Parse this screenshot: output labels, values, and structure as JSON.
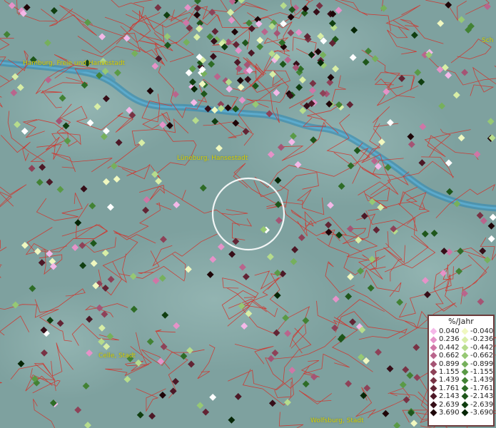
{
  "map": {
    "places": [
      {
        "name": "Hamburg, Freie und Hansestadt"
      },
      {
        "name": "Lüneburg, Hansestadt"
      },
      {
        "name": "Celle, Stadt"
      },
      {
        "name": "Wolfsburg, Stadt"
      },
      {
        "name": "Sch"
      }
    ]
  },
  "legend": {
    "title": "%/Jahr",
    "positive": [
      {
        "value": "0.040",
        "color": "#f4b8e8"
      },
      {
        "value": "0.236",
        "color": "#e592c8"
      },
      {
        "value": "0.442",
        "color": "#cf76a6"
      },
      {
        "value": "0.662",
        "color": "#b9658c"
      },
      {
        "value": "0.899",
        "color": "#a55474"
      },
      {
        "value": "1.155",
        "color": "#8e4258"
      },
      {
        "value": "1.439",
        "color": "#783244"
      },
      {
        "value": "1.761",
        "color": "#622434"
      },
      {
        "value": "2.143",
        "color": "#4c1826"
      },
      {
        "value": "2.639",
        "color": "#360e18"
      },
      {
        "value": "3.690",
        "color": "#1e0508"
      }
    ],
    "negative": [
      {
        "value": "-0.040",
        "color": "#f0f8c0"
      },
      {
        "value": "-0.236",
        "color": "#d8eea6"
      },
      {
        "value": "-0.442",
        "color": "#b6dc8c"
      },
      {
        "value": "-0.662",
        "color": "#96c874"
      },
      {
        "value": "-0.899",
        "color": "#76b05c"
      },
      {
        "value": "-1.155",
        "color": "#5a9a46"
      },
      {
        "value": "-1.439",
        "color": "#428234"
      },
      {
        "value": "-1.761",
        "color": "#2e6c26"
      },
      {
        "value": "-2.143",
        "color": "#1e561a"
      },
      {
        "value": "-2.639",
        "color": "#103e10"
      },
      {
        "value": "-3.690",
        "color": "#062606"
      }
    ]
  }
}
